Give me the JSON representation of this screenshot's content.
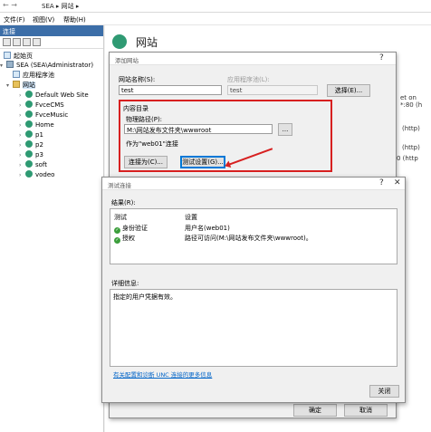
{
  "window": {
    "nav_arrows": "← →",
    "breadcrumb": "SEA  ▸  网站  ▸",
    "menu": [
      "文件(F)",
      "视图(V)",
      "帮助(H)"
    ]
  },
  "connections": {
    "title": "连接",
    "tree": [
      {
        "label": "起始页",
        "icon": "start-page-icon"
      },
      {
        "label": "SEA (SEA\\Administrator)",
        "icon": "server-icon"
      },
      {
        "label": "应用程序池",
        "icon": "app-pool-icon"
      },
      {
        "label": "网站",
        "icon": "folder-icon"
      },
      {
        "label": "Default Web Site",
        "icon": "globe-icon"
      },
      {
        "label": "FvceCMS",
        "icon": "globe-icon"
      },
      {
        "label": "FvceMusic",
        "icon": "globe-icon"
      },
      {
        "label": "Home",
        "icon": "globe-icon"
      },
      {
        "label": "p1",
        "icon": "globe-icon"
      },
      {
        "label": "p2",
        "icon": "globe-icon"
      },
      {
        "label": "p3",
        "icon": "globe-icon"
      },
      {
        "label": "soft",
        "icon": "globe-icon"
      },
      {
        "label": "vodeo",
        "icon": "globe-icon"
      }
    ]
  },
  "main": {
    "title": "网站",
    "bg_texts": [
      "et on *:80 (h",
      "(http)",
      "(http)",
      "0 (http"
    ]
  },
  "add_site_dialog": {
    "title": "添加网站",
    "help": "?",
    "site_name_label": "网站名称(S):",
    "site_name_value": "test",
    "app_pool_label": "应用程序池(L):",
    "app_pool_value": "test",
    "select_button": "选择(E)...",
    "content_dir_label": "内容目录",
    "physical_path_label": "物理路径(P):",
    "physical_path_value": "M:\\网站发布文件夹\\wwwroot",
    "browse_button": "...",
    "pass_through_label": "作为\"web01\"连接",
    "connect_as_button": "连接为(C)...",
    "test_settings_button": "测试设置(G)...",
    "ok_button": "确定",
    "cancel_button": "取消"
  },
  "test_dialog": {
    "title": "测试连接",
    "help": "?",
    "close_x": "✕",
    "results_label": "结果(R):",
    "col_test": "测试",
    "col_settings": "设置",
    "rows": [
      {
        "test": "身份验证",
        "setting": "用户名(web01)"
      },
      {
        "test": "授权",
        "setting": "路径可访问(M:\\网站发布文件夹\\wwwroot)。"
      }
    ],
    "details_label": "详细信息:",
    "details_text": "指定的用户凭据有效。",
    "link": "有关配置和诊断 UNC 连接的更多信息",
    "close_button": "关闭"
  },
  "colors": {
    "annotation_red": "#d72020",
    "accent_blue": "#0078d7",
    "site_green": "#2f9a73"
  }
}
